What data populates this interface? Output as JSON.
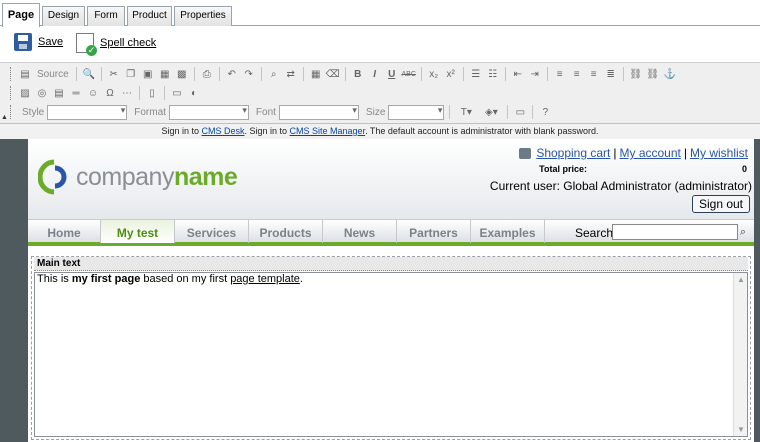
{
  "tabs": [
    {
      "label": "Page",
      "active": true
    },
    {
      "label": "Design"
    },
    {
      "label": "Form"
    },
    {
      "label": "Product"
    },
    {
      "label": "Properties"
    }
  ],
  "actions": {
    "save": "Save",
    "spell": "Spell check"
  },
  "toolbar": {
    "source": "Source",
    "style": "Style",
    "format": "Format",
    "font": "Font",
    "size": "Size",
    "bold": "B",
    "italic": "I",
    "underline": "U",
    "strike": "ABC",
    "subscript": "x₂",
    "superscript": "x²"
  },
  "notice": {
    "p1": "Sign in to ",
    "cms_desk": "CMS Desk",
    "p2": ". Sign in to ",
    "site_manager": "CMS Site Manager",
    "p3": ". The default account is administrator with blank password."
  },
  "header": {
    "logo_light": "company",
    "logo_bold": "name",
    "shopping_cart": "Shopping cart",
    "my_account": "My account",
    "my_wishlist": "My wishlist",
    "divider": "|",
    "total_price_label": "Total price:",
    "total_price_value": "0",
    "current_user": "Current user:  Global Administrator (administrator)",
    "sign_out": "Sign out"
  },
  "menu": {
    "items": [
      "Home",
      "My test",
      "Services",
      "Products",
      "News",
      "Partners",
      "Examples"
    ],
    "active_index": 1,
    "search_label": "Search:",
    "search_value": ""
  },
  "content": {
    "zone_title": "Main text",
    "t1": "This is ",
    "t2": "my first page",
    "t3": " based on my first ",
    "t4": "page template",
    "t5": "."
  },
  "colors": {
    "brand_green": "#6cab2a",
    "link_blue": "#2b56a7",
    "frame": "#4e5a5e"
  }
}
